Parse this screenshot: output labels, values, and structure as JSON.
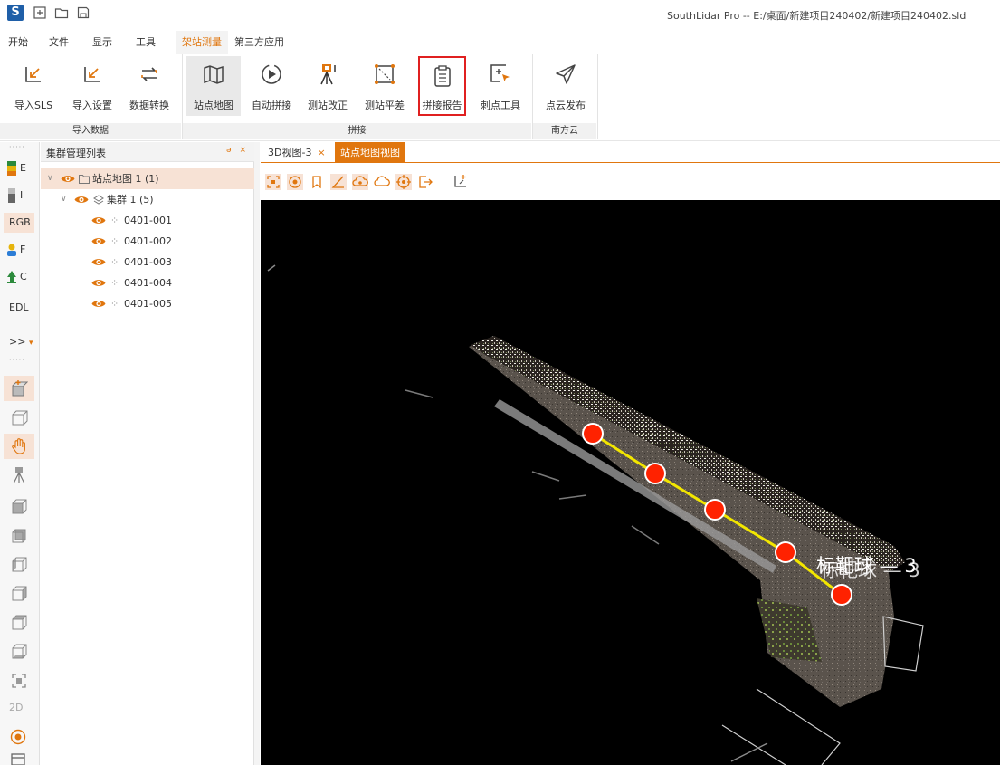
{
  "window": {
    "title": "SouthLidar Pro -- E:/桌面/新建项目240402/新建项目240402.sld",
    "logo_text": "S"
  },
  "quick_access": [
    {
      "icon": "add-file-icon"
    },
    {
      "icon": "open-folder-icon"
    },
    {
      "icon": "save-icon"
    }
  ],
  "menu": {
    "tabs": [
      "开始",
      "文件",
      "显示",
      "工具",
      "架站测量",
      "第三方应用"
    ],
    "active": "架站测量"
  },
  "ribbon": {
    "groups": [
      {
        "label": "导入数据",
        "buttons": [
          {
            "label": "导入SLS",
            "icon": "import-arrow-icon"
          },
          {
            "label": "导入设置",
            "icon": "import-settings-icon"
          },
          {
            "label": "数据转换",
            "icon": "convert-arrows-icon"
          }
        ]
      },
      {
        "label": "拼接",
        "buttons": [
          {
            "label": "站点地图",
            "icon": "map-icon",
            "state": "selected"
          },
          {
            "label": "自动拼接",
            "icon": "play-circle-icon"
          },
          {
            "label": "测站改正",
            "icon": "tripod-scanner-icon"
          },
          {
            "label": "测站平差",
            "icon": "adjustment-square-icon"
          },
          {
            "label": "拼接报告",
            "icon": "clipboard-report-icon",
            "state": "highlighted"
          },
          {
            "label": "刺点工具",
            "icon": "point-cursor-icon"
          }
        ]
      },
      {
        "label": "南方云",
        "buttons": [
          {
            "label": "点云发布",
            "icon": "paper-plane-icon"
          }
        ]
      }
    ],
    "accent": "#e0760e",
    "highlight_color": "#e02020"
  },
  "left_toolbar": {
    "items": [
      "E",
      "I",
      "RGB",
      "F",
      "C",
      "EDL",
      ">>"
    ],
    "overflow_marker": "▾",
    "icons": [
      "cube-plus-icon",
      "cube-edit-icon",
      "hand-pan-icon",
      "tripod-icon",
      "cube-front-icon",
      "cube-back-icon",
      "cube-left-icon",
      "cube-right-icon",
      "cube-top-icon",
      "cube-bottom-icon",
      "fit-view-icon"
    ],
    "bottom_labels": [
      "2D"
    ],
    "bottom_icons": [
      "target-icon",
      "panel-icon"
    ]
  },
  "tree_panel": {
    "title": "集群管理列表",
    "header_buttons": "ə ×",
    "root": {
      "label": "站点地图 1 (1)"
    },
    "cluster": {
      "label": "集群 1 (5)"
    },
    "stations": [
      "0401-001",
      "0401-002",
      "0401-003",
      "0401-004",
      "0401-005"
    ]
  },
  "view_tabs": {
    "tabs": [
      {
        "label": "3D视图-3",
        "close": "×"
      },
      {
        "label": "站点地图视图"
      }
    ],
    "active_index": 1
  },
  "view_toolbar": {
    "icons": [
      "fit-frame-icon",
      "target-circle-icon",
      "bookmark-icon",
      "angle-measure-icon",
      "cloud-eye-icon",
      "cloud-outline-icon",
      "crosshair-circle-icon",
      "export-icon",
      "axis-plus-icon"
    ]
  },
  "viewport": {
    "background": "#000000",
    "station_color": "#ff2200",
    "link_color": "#f2e600",
    "labels": [
      {
        "text": "标靶球 — 3"
      },
      {
        "text": "标靶球 — 3"
      }
    ]
  }
}
